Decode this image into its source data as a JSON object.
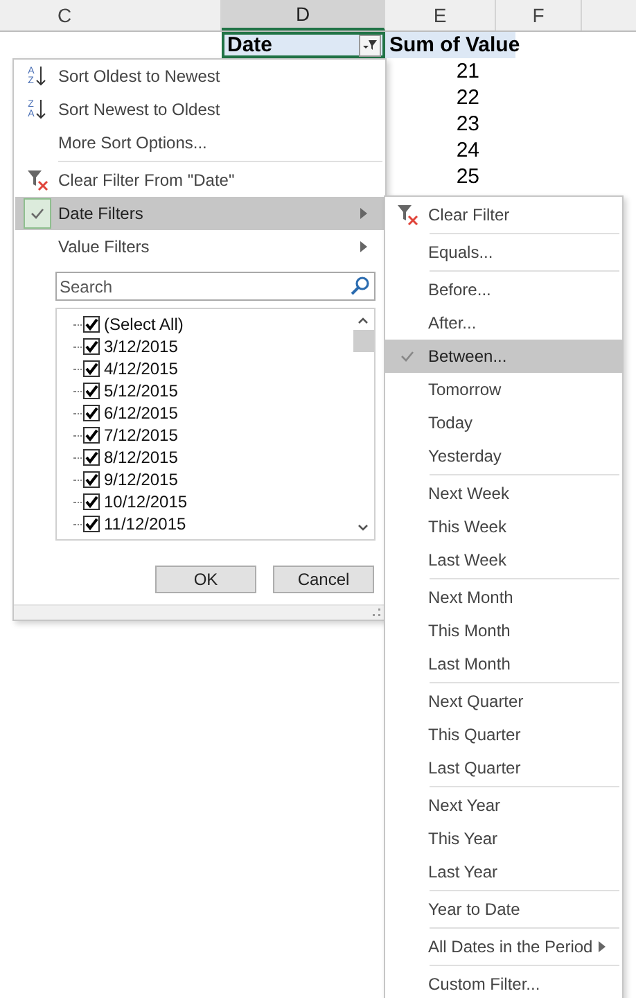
{
  "sheet": {
    "columns": [
      {
        "label": "C",
        "selected": false
      },
      {
        "label": "D",
        "selected": true
      },
      {
        "label": "E",
        "selected": false
      },
      {
        "label": "F",
        "selected": false
      }
    ],
    "header_row": {
      "date": "Date",
      "sum": "Sum of Value"
    },
    "values": [
      "21",
      "22",
      "23",
      "24",
      "25"
    ]
  },
  "filter_menu": {
    "items": [
      {
        "kind": "sort",
        "icon_letters": [
          "A",
          "Z"
        ],
        "label": "Sort Oldest to Newest",
        "highlighted": false,
        "checked": false
      },
      {
        "kind": "sort",
        "icon_letters": [
          "Z",
          "A"
        ],
        "label": "Sort Newest to Oldest",
        "highlighted": false,
        "checked": false
      },
      {
        "kind": "plain",
        "label": "More Sort Options...",
        "highlighted": false,
        "checked": false
      },
      {
        "kind": "separator"
      },
      {
        "kind": "clear",
        "label": "Clear Filter From \"Date\"",
        "highlighted": false,
        "checked": false
      },
      {
        "kind": "submenu",
        "label": "Date Filters",
        "highlighted": true,
        "checked": true
      },
      {
        "kind": "submenu",
        "label": "Value Filters",
        "highlighted": false,
        "checked": false
      }
    ],
    "search": {
      "placeholder": "Search"
    },
    "list": [
      {
        "label": "(Select All)",
        "checked": true
      },
      {
        "label": "3/12/2015",
        "checked": true
      },
      {
        "label": "4/12/2015",
        "checked": true
      },
      {
        "label": "5/12/2015",
        "checked": true
      },
      {
        "label": "6/12/2015",
        "checked": true
      },
      {
        "label": "7/12/2015",
        "checked": true
      },
      {
        "label": "8/12/2015",
        "checked": true
      },
      {
        "label": "9/12/2015",
        "checked": true
      },
      {
        "label": "10/12/2015",
        "checked": true
      },
      {
        "label": "11/12/2015",
        "checked": true
      }
    ],
    "buttons": [
      "OK",
      "Cancel"
    ]
  },
  "date_filters_menu": {
    "items": [
      {
        "kind": "clear",
        "label": "Clear Filter",
        "selected": false
      },
      {
        "kind": "separator"
      },
      {
        "kind": "plain",
        "label": "Equals...",
        "selected": false
      },
      {
        "kind": "separator"
      },
      {
        "kind": "plain",
        "label": "Before...",
        "selected": false
      },
      {
        "kind": "plain",
        "label": "After...",
        "selected": false
      },
      {
        "kind": "plain",
        "label": "Between...",
        "selected": true
      },
      {
        "kind": "plain",
        "label": "Tomorrow",
        "selected": false
      },
      {
        "kind": "plain",
        "label": "Today",
        "selected": false
      },
      {
        "kind": "plain",
        "label": "Yesterday",
        "selected": false
      },
      {
        "kind": "separator"
      },
      {
        "kind": "plain",
        "label": "Next Week",
        "selected": false
      },
      {
        "kind": "plain",
        "label": "This Week",
        "selected": false
      },
      {
        "kind": "plain",
        "label": "Last Week",
        "selected": false
      },
      {
        "kind": "separator"
      },
      {
        "kind": "plain",
        "label": "Next Month",
        "selected": false
      },
      {
        "kind": "plain",
        "label": "This Month",
        "selected": false
      },
      {
        "kind": "plain",
        "label": "Last Month",
        "selected": false
      },
      {
        "kind": "separator"
      },
      {
        "kind": "plain",
        "label": "Next Quarter",
        "selected": false
      },
      {
        "kind": "plain",
        "label": "This Quarter",
        "selected": false
      },
      {
        "kind": "plain",
        "label": "Last Quarter",
        "selected": false
      },
      {
        "kind": "separator"
      },
      {
        "kind": "plain",
        "label": "Next Year",
        "selected": false
      },
      {
        "kind": "plain",
        "label": "This Year",
        "selected": false
      },
      {
        "kind": "plain",
        "label": "Last Year",
        "selected": false
      },
      {
        "kind": "separator"
      },
      {
        "kind": "plain",
        "label": "Year to Date",
        "selected": false
      },
      {
        "kind": "separator"
      },
      {
        "kind": "submenu",
        "label": "All Dates in the Period",
        "selected": false
      },
      {
        "kind": "separator"
      },
      {
        "kind": "plain",
        "label": "Custom Filter...",
        "selected": false
      }
    ]
  }
}
